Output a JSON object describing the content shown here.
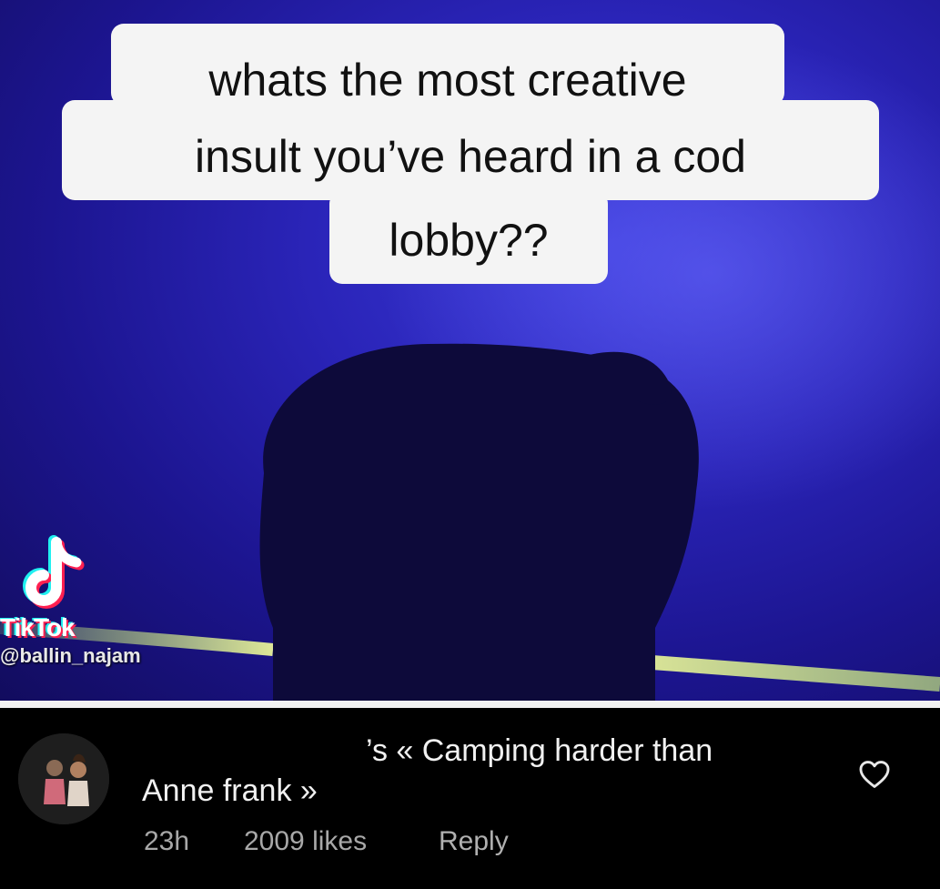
{
  "video": {
    "caption_lines": [
      "whats the most creative",
      "insult you’ve heard in a cod",
      "lobby??"
    ],
    "watermark": {
      "brand": "TikTok",
      "handle": "@ballin_najam"
    }
  },
  "comment": {
    "text_line1": "’s « Camping harder than",
    "text_line2": "Anne frank »",
    "time": "23h",
    "likes": "2009 likes",
    "reply_label": "Reply",
    "like_icon": "heart-outline-icon"
  },
  "colors": {
    "background": "#2a24b8",
    "caption_bg": "#f4f4f4",
    "comment_bg": "#000000",
    "meta_text": "#a8a8a8"
  }
}
